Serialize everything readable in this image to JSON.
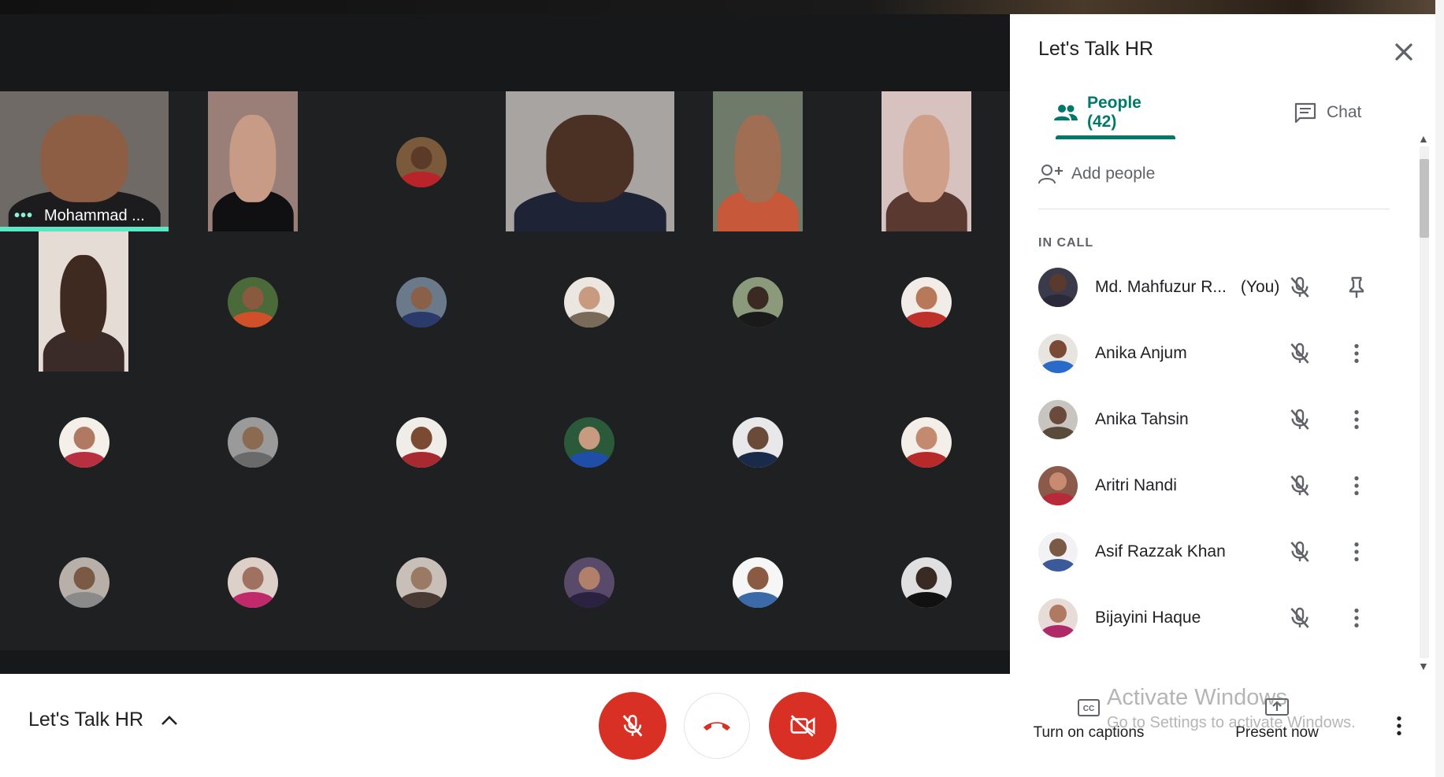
{
  "window": {
    "accent_color": "#00796b",
    "danger_color": "#d93025",
    "speaking_color": "#5ee6c4"
  },
  "stage": {
    "featured_tiles": [
      {
        "name": "Mohammad ...",
        "bg": "#6f6a66",
        "skin": "#8d5e44",
        "shirt": "#1c1c1e",
        "speaking": true
      },
      {
        "name": "",
        "bg": "#9a7f78",
        "skin": "#c79b85",
        "shirt": "#101012"
      },
      {
        "name": "",
        "bg": "#a8a4a2",
        "skin": "#4b3024",
        "shirt": "#1e2435"
      },
      {
        "name": "",
        "bg": "#6f7a6a",
        "skin": "#a06e52",
        "shirt": "#c7583a"
      },
      {
        "name": "",
        "bg": "#d8c2c0",
        "skin": "#cf9f8a",
        "shirt": "#5a3a30"
      },
      {
        "name": "",
        "bg": "#e6dcd6",
        "skin": "#3f2a22",
        "shirt": "#3a2a28"
      }
    ],
    "avatars": [
      {
        "bg": "#7a5a3a",
        "skin": "#5b3a2a",
        "shirt": "#b8242a"
      },
      {
        "bg": "#4a6a3a",
        "skin": "#8a5a40",
        "shirt": "#d0502a"
      },
      {
        "bg": "#6a7a8a",
        "skin": "#8a6048",
        "shirt": "#2a3a6a"
      },
      {
        "bg": "#ece6e0",
        "skin": "#c89a80",
        "shirt": "#7a6a5a"
      },
      {
        "bg": "#8a9a7a",
        "skin": "#3a2a22",
        "shirt": "#1a1a1a"
      },
      {
        "bg": "#f2ece8",
        "skin": "#b8785a",
        "shirt": "#c0302a"
      },
      {
        "bg": "#f5efea",
        "skin": "#b07a62",
        "shirt": "#b83040"
      },
      {
        "bg": "#9a9a9a",
        "skin": "#8a6a50",
        "shirt": "#6a6a6a"
      },
      {
        "bg": "#f0ece8",
        "skin": "#7a4a32",
        "shirt": "#a82a30"
      },
      {
        "bg": "#2a5a3a",
        "skin": "#c89a80",
        "shirt": "#1e4ea8"
      },
      {
        "bg": "#e8e8ea",
        "skin": "#6a4a38",
        "shirt": "#1a2a4a"
      },
      {
        "bg": "#f4eee8",
        "skin": "#c48a70",
        "shirt": "#b82a2a"
      },
      {
        "bg": "#b8b0a8",
        "skin": "#7a5a44",
        "shirt": "#8a8a8a"
      },
      {
        "bg": "#dcd0c8",
        "skin": "#a07060",
        "shirt": "#c02a6a"
      },
      {
        "bg": "#c8c0b8",
        "skin": "#9a7a64",
        "shirt": "#4a3a34"
      },
      {
        "bg": "#5a4a6a",
        "skin": "#b0806a",
        "shirt": "#2a2240"
      },
      {
        "bg": "#f6f6f6",
        "skin": "#8a5a42",
        "shirt": "#3a6aa8"
      },
      {
        "bg": "#e0e0e0",
        "skin": "#3a2a24",
        "shirt": "#111111"
      }
    ]
  },
  "panel": {
    "title": "Let's Talk HR",
    "tabs": {
      "people": "People (42)",
      "chat": "Chat"
    },
    "add_people": "Add people",
    "section": "IN CALL",
    "participants": [
      {
        "name": "Md. Mahfuzur R...",
        "you": "(You)",
        "action": "pin",
        "bg": "#3a3a4a",
        "skin": "#5a3a2e",
        "shirt": "#2a2a3a"
      },
      {
        "name": "Anika Anjum",
        "action": "more",
        "bg": "#e8e4e0",
        "skin": "#7a4a36",
        "shirt": "#2a6ac8"
      },
      {
        "name": "Anika Tahsin",
        "action": "more",
        "bg": "#c8c4c0",
        "skin": "#6a4a3a",
        "shirt": "#5a4a3a"
      },
      {
        "name": "Aritri Nandi",
        "action": "more",
        "bg": "#8a5a4a",
        "skin": "#c88a70",
        "shirt": "#b82a3a"
      },
      {
        "name": "Asif Razzak Khan",
        "action": "more",
        "bg": "#f2f2f4",
        "skin": "#7a5a44",
        "shirt": "#3a5a9a"
      },
      {
        "name": "Bijayini Haque",
        "action": "more",
        "bg": "#e8dcd8",
        "skin": "#b07a62",
        "shirt": "#b02a6a"
      }
    ]
  },
  "bottom": {
    "meeting_name": "Let's Talk HR",
    "captions_label": "Turn on captions",
    "present_label": "Present now",
    "watermark_line1": "Activate Windows",
    "watermark_line2": "Go to Settings to activate Windows."
  }
}
